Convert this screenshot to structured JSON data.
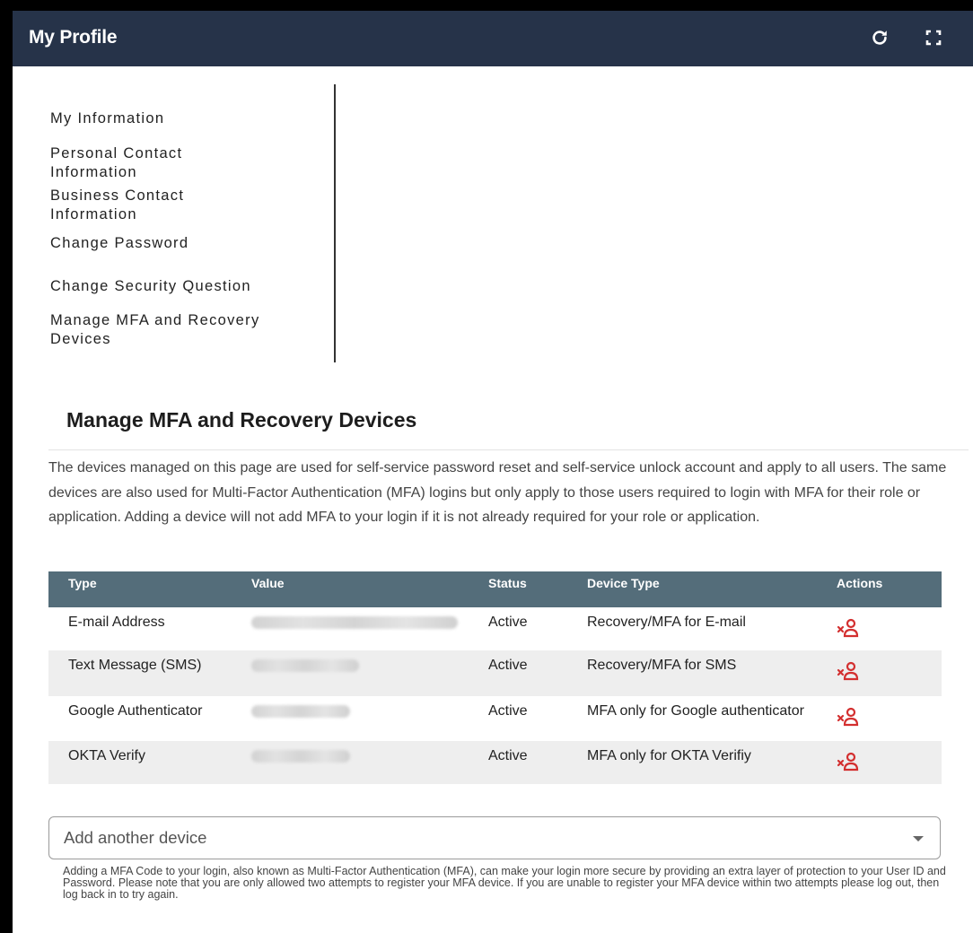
{
  "window": {
    "title": "My Profile",
    "refresh_icon": "refresh-icon",
    "fullscreen_icon": "fullscreen-icon"
  },
  "sidebar": {
    "items": [
      {
        "label": "My Information"
      },
      {
        "label": "Personal Contact Information"
      },
      {
        "label": "Business Contact Information"
      },
      {
        "label": "Change Password"
      },
      {
        "label": "Change Security Question"
      },
      {
        "label": "Manage MFA and Recovery Devices"
      }
    ]
  },
  "main": {
    "title": "Manage MFA and Recovery Devices",
    "description": "The devices managed on this page are used for self-service password reset and self-service unlock account and apply to all users. The same devices are also used for Multi-Factor Authentication (MFA) logins but only apply to those users required to login with MFA for their role or application. Adding a device will not add MFA to your login if it is not already required for your role or application.",
    "table": {
      "columns": [
        "Type",
        "Value",
        "Status",
        "Device Type",
        "Actions"
      ],
      "rows": [
        {
          "type": "E-mail Address",
          "value": "",
          "status": "Active",
          "device_type": "Recovery/MFA for E-mail",
          "action_icon": "remove-user-icon"
        },
        {
          "type": "Text Message (SMS)",
          "value": "",
          "status": "Active",
          "device_type": "Recovery/MFA for SMS",
          "action_icon": "remove-user-icon"
        },
        {
          "type": "Google Authenticator",
          "value": "",
          "status": "Active",
          "device_type": "MFA only for Google authenticator",
          "action_icon": "remove-user-icon"
        },
        {
          "type": "OKTA Verify",
          "value": "",
          "status": "Active",
          "device_type": "MFA only for OKTA Verifiy",
          "action_icon": "remove-user-icon"
        }
      ]
    },
    "add_device": {
      "placeholder": "Add another device",
      "help_text": "Adding a MFA Code to your login, also known as Multi-Factor Authentication (MFA), can make your login more secure by providing an extra layer of protection to your User ID and Password. Please note that you are only allowed two attempts to register your MFA device. If you are unable to register your MFA device within two attempts please log out, then log back in to try again."
    }
  },
  "colors": {
    "titlebar": "#263349",
    "table_header": "#546d7a",
    "action_red": "#d32f2f",
    "row_alt": "#eeeeee"
  }
}
